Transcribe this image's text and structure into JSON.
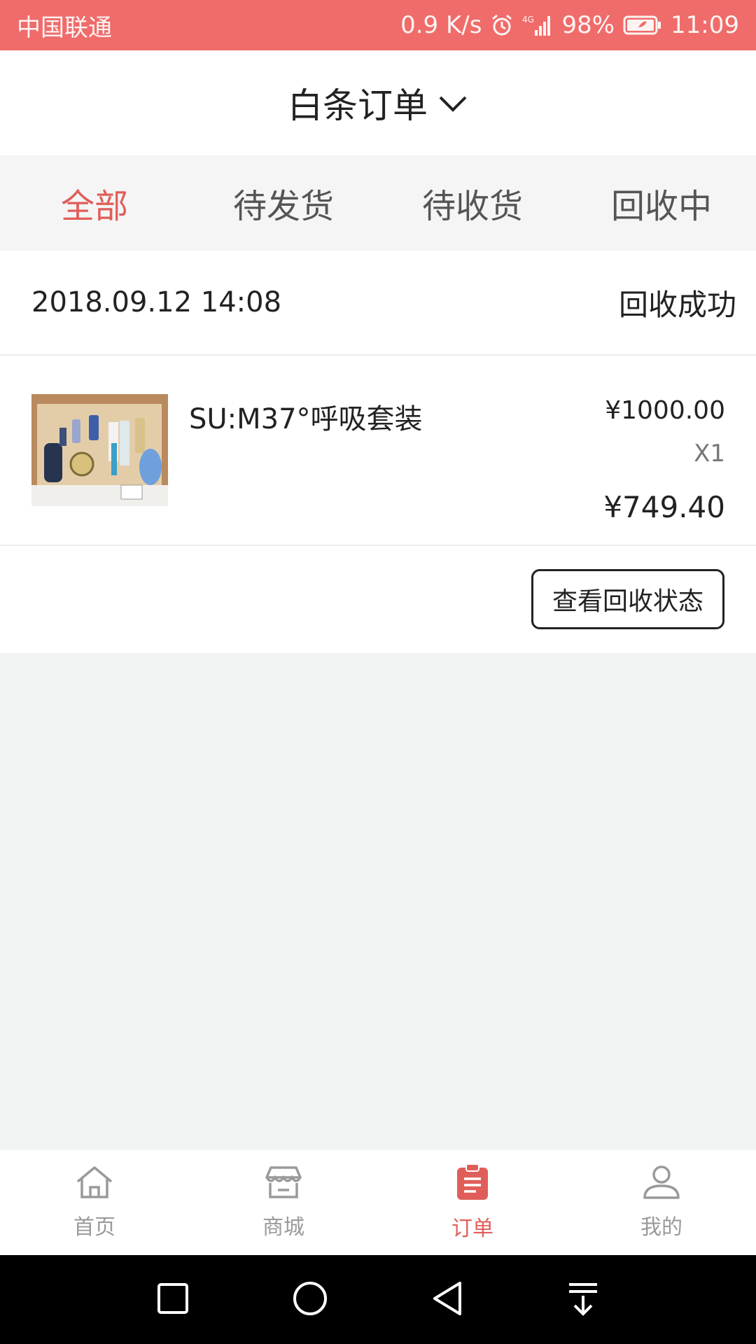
{
  "status_bar": {
    "carrier": "中国联通",
    "speed": "0.9 K/s",
    "network": "4G",
    "battery": "98%",
    "time": "11:09"
  },
  "header": {
    "title": "白条订单",
    "chevron_icon": "chevron-down-icon"
  },
  "tabs": [
    {
      "label": "全部",
      "active": true
    },
    {
      "label": "待发货",
      "active": false
    },
    {
      "label": "待收货",
      "active": false
    },
    {
      "label": "回收中",
      "active": false
    }
  ],
  "order": {
    "time": "2018.09.12 14:08",
    "status": "回收成功",
    "item": {
      "name": "SU:M37°呼吸套装",
      "price": "¥1000.00",
      "quantity": "X1",
      "total": "¥749.40"
    },
    "action_label": "查看回收状态"
  },
  "bottom_nav": [
    {
      "label": "首页",
      "icon": "home-icon",
      "active": false
    },
    {
      "label": "商城",
      "icon": "store-icon",
      "active": false
    },
    {
      "label": "订单",
      "icon": "order-icon",
      "active": true
    },
    {
      "label": "我的",
      "icon": "profile-icon",
      "active": false
    }
  ],
  "colors": {
    "accent": "#e05e5a",
    "status_bar": "#ef6c6a",
    "background": "#f2f3f3"
  }
}
